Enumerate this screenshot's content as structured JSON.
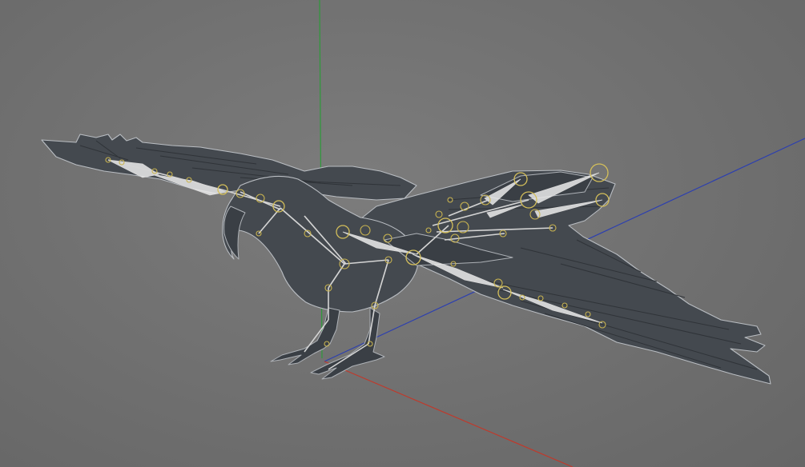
{
  "viewport": {
    "background": "#6e6e6e",
    "mesh_color": "#44494f",
    "outline_color": "#b9bdc2",
    "bone_color": "#e6e6e6",
    "joint_color": "#d4bf5a",
    "axis_colors": {
      "x": "#c0392b",
      "y": "#2e9a3a",
      "z": "#2c3fb0"
    },
    "model": "rigged-bird"
  }
}
